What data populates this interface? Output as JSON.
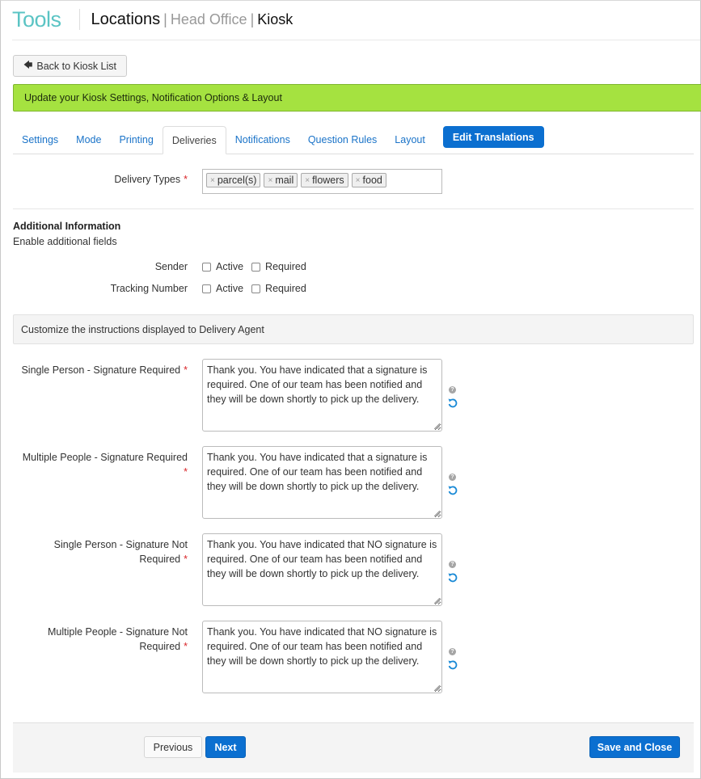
{
  "header": {
    "brand": "Tools",
    "breadcrumb": [
      "Locations",
      "Head Office",
      "Kiosk"
    ],
    "divider": "|"
  },
  "back_button": {
    "label": "Back to Kiosk List",
    "icon": "arrow-left-icon"
  },
  "banner": {
    "text": "Update your Kiosk Settings, Notification Options & Layout",
    "color": "#a5e240"
  },
  "tabs": {
    "items": [
      {
        "label": "Settings",
        "active": false
      },
      {
        "label": "Mode",
        "active": false
      },
      {
        "label": "Printing",
        "active": false
      },
      {
        "label": "Deliveries",
        "active": true
      },
      {
        "label": "Notifications",
        "active": false
      },
      {
        "label": "Question Rules",
        "active": false
      },
      {
        "label": "Layout",
        "active": false
      }
    ],
    "action_label": "Edit Translations"
  },
  "delivery_types": {
    "label": "Delivery Types",
    "required_mark": "*",
    "tags": [
      "parcel(s)",
      "mail",
      "flowers",
      "food"
    ],
    "remove_glyph": "×"
  },
  "additional_info": {
    "title": "Additional Information",
    "subtitle": "Enable additional fields",
    "fields": [
      {
        "label": "Sender",
        "active_label": "Active",
        "active": false,
        "required_label": "Required",
        "required": false
      },
      {
        "label": "Tracking Number",
        "active_label": "Active",
        "active": false,
        "required_label": "Required",
        "required": false
      }
    ]
  },
  "instructions": {
    "header": "Customize the instructions displayed to Delivery Agent",
    "items": [
      {
        "label": "Single Person - Signature Required",
        "required_mark": "*",
        "value": "Thank you. You have indicated that a signature is required. One of our team has been notified and they will be down shortly to pick up the delivery."
      },
      {
        "label": "Multiple People - Signature Required",
        "required_mark": "*",
        "value": "Thank you. You have indicated that a signature is required. One of our team has been notified and they will be down shortly to pick up the delivery."
      },
      {
        "label": "Single Person - Signature Not Required",
        "required_mark": "*",
        "value": "Thank you. You have indicated that NO signature is required. One of our team has been notified and they will be down shortly to pick up the delivery."
      },
      {
        "label": "Multiple People - Signature Not Required",
        "required_mark": "*",
        "value": "Thank you. You have indicated that NO signature is required. One of our team has been notified and they will be down shortly to pick up the delivery."
      }
    ],
    "help_glyph": "?"
  },
  "footer": {
    "previous_label": "Previous",
    "next_label": "Next",
    "save_label": "Save and Close",
    "primary_color": "#0b6fd0"
  }
}
